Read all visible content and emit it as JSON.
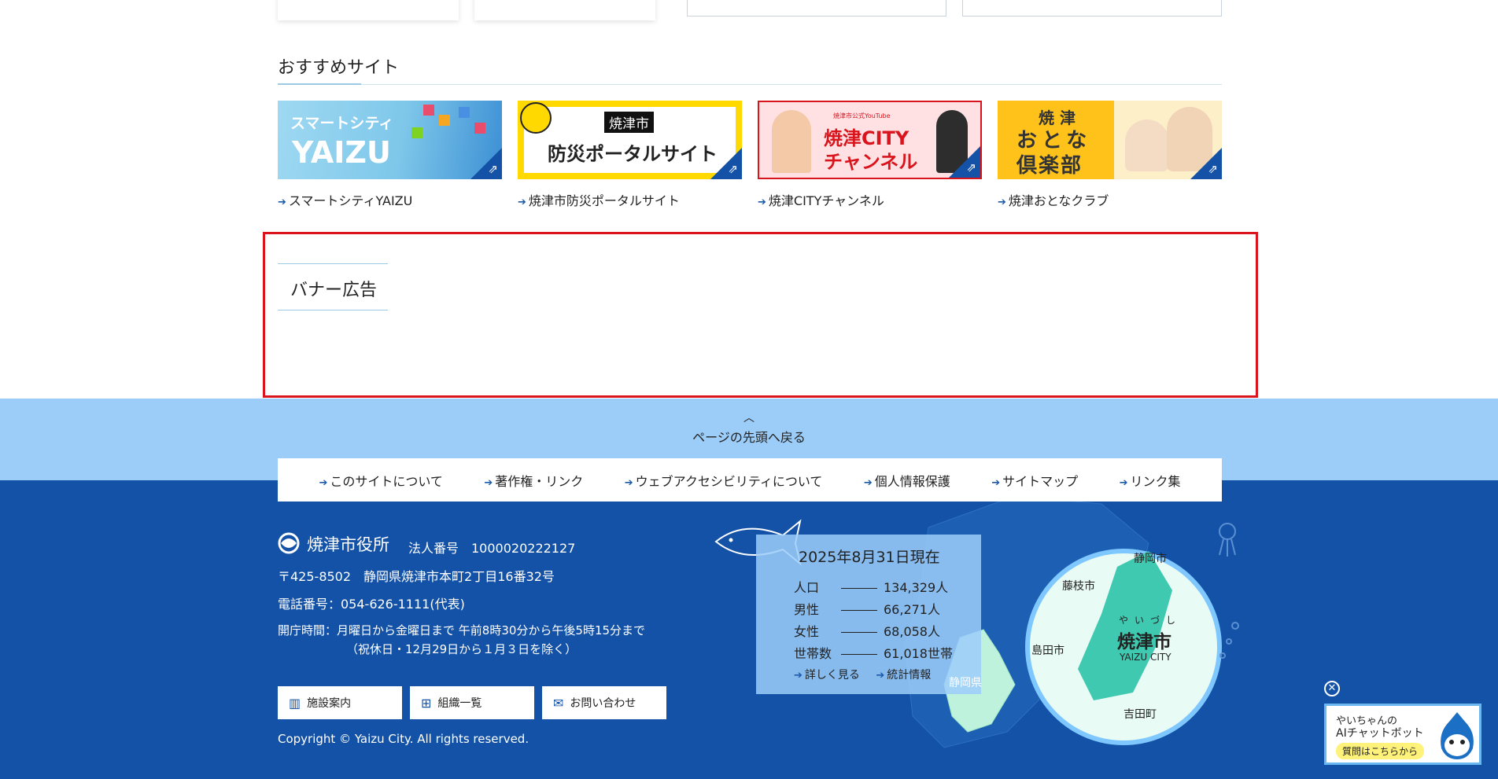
{
  "recommended": {
    "title": "おすすめサイト",
    "items": [
      {
        "label": "スマートシティYAIZU",
        "img_line1": "スマートシティ",
        "img_line2": "YAIZU"
      },
      {
        "label": "焼津市防災ポータルサイト",
        "img_tag": "焼津市",
        "img_text": "防災ポータルサイト"
      },
      {
        "label": "焼津CITYチャンネル",
        "img_small": "焼津市公式YouTube",
        "img_line1": "焼津CITY",
        "img_line2": "チャンネル"
      },
      {
        "label": "焼津おとなクラブ",
        "img_line1": "焼 津",
        "img_line2": "おとな",
        "img_line3": "倶楽部"
      }
    ]
  },
  "banner": {
    "title": "バナー広告"
  },
  "page_top": {
    "label": "ページの先頭へ戻る"
  },
  "footer_nav": [
    "このサイトについて",
    "著作権・リンク",
    "ウェブアクセシビリティについて",
    "個人情報保護",
    "サイトマップ",
    "リンク集"
  ],
  "office": {
    "name": "焼津市役所",
    "corp_no": "法人番号　1000020222127",
    "address": "〒425-8502　静岡県焼津市本町2丁目16番32号",
    "phone": "電話番号：054-626-1111(代表)",
    "hours": "開庁時間：月曜日から金曜日まで 午前8時30分から午後5時15分まで",
    "hours_note": "（祝休日・12月29日から１月３日を除く）"
  },
  "footer_buttons": [
    {
      "label": "施設案内",
      "icon": "building-icon"
    },
    {
      "label": "組織一覧",
      "icon": "org-chart-icon"
    },
    {
      "label": "お問い合わせ",
      "icon": "mail-icon"
    }
  ],
  "copyright": "Copyright © Yaizu City. All rights reserved.",
  "stats": {
    "date": "2025年8月31日現在",
    "rows": [
      {
        "label": "人口",
        "value": "134,329人"
      },
      {
        "label": "男性",
        "value": "66,271人"
      },
      {
        "label": "女性",
        "value": "68,058人"
      },
      {
        "label": "世帯数",
        "value": "61,018世帯"
      }
    ],
    "link_more": "詳しく見る",
    "link_stats": "統計情報"
  },
  "map": {
    "pref": "静岡県",
    "city_ruby": "やいづし",
    "city": "焼津市",
    "city_en": "YAIZU CITY",
    "neighbors": [
      "静岡市",
      "藤枝市",
      "島田市",
      "吉田町"
    ]
  },
  "chatbot": {
    "line1": "やいちゃんの",
    "line2": "AIチャットボット",
    "cta": "質問はこちらから"
  },
  "colors": {
    "footer_bg": "#1352a6",
    "pagetop_bg": "#9ccdf9",
    "highlight": "#d9141c"
  }
}
